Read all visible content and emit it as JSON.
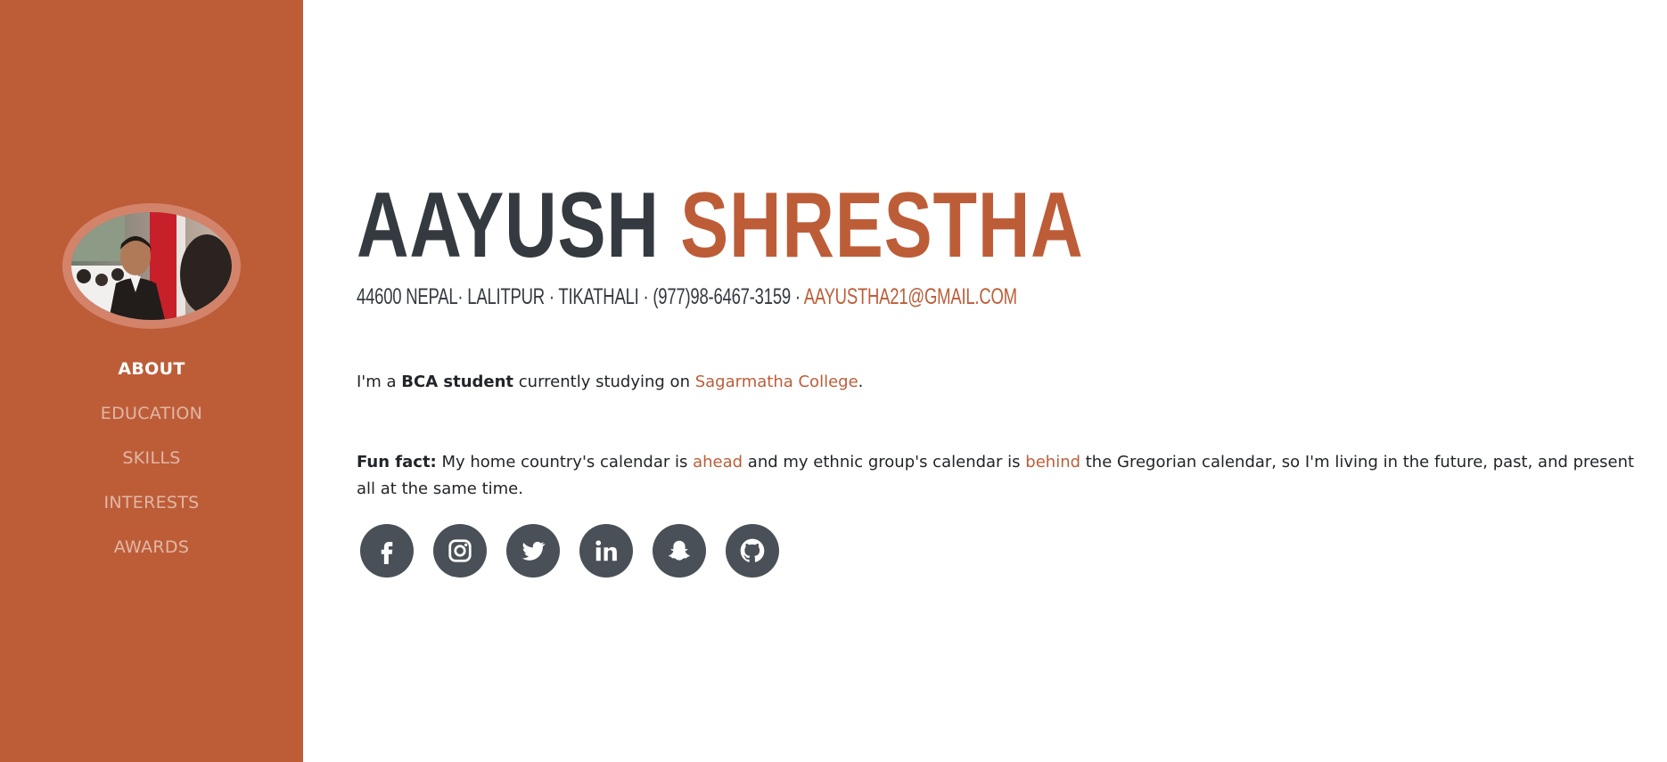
{
  "sidebar": {
    "avatar_alt": "Profile photo",
    "nav": [
      {
        "label": "ABOUT",
        "active": true
      },
      {
        "label": "EDUCATION",
        "active": false
      },
      {
        "label": "SKILLS",
        "active": false
      },
      {
        "label": "INTERESTS",
        "active": false
      },
      {
        "label": "AWARDS",
        "active": false
      }
    ]
  },
  "about": {
    "first_name": "AAYUSH",
    "last_name": "SHRESTHA",
    "address": "44600 NEPAL· LALITPUR · TIKATHALI · (977)98-6467-3159 · ",
    "email": "AAYUSTHA21@GMAIL.COM",
    "intro": {
      "prefix": "I'm a ",
      "bold": "BCA student",
      "middle": " currently studying on ",
      "link": "Sagarmatha College",
      "suffix": "."
    },
    "fun_fact": {
      "label": "Fun fact:",
      "part1": " My home country's calendar is ",
      "link1": "ahead",
      "part2": " and my ethnic group's calendar is ",
      "link2": "behind",
      "part3": " the Gregorian calendar, so I'm living in the future, past, and present all at the same time."
    },
    "social": [
      {
        "icon": "facebook-icon"
      },
      {
        "icon": "instagram-icon"
      },
      {
        "icon": "twitter-icon"
      },
      {
        "icon": "linkedin-icon"
      },
      {
        "icon": "snapchat-icon"
      },
      {
        "icon": "github-icon"
      }
    ]
  },
  "colors": {
    "primary": "#bd5d38",
    "dark": "#343a40",
    "icon_bg": "#495057",
    "avatar_ring": "#d4836b"
  }
}
